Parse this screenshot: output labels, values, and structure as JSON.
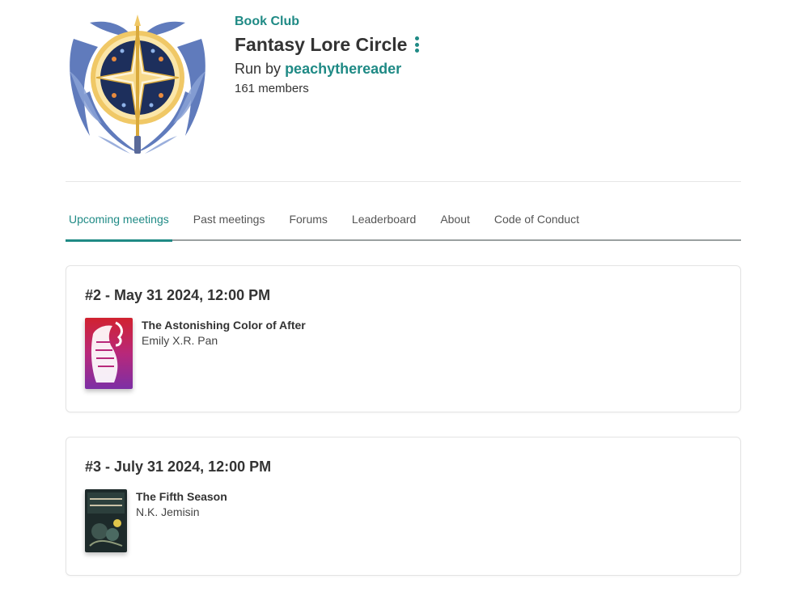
{
  "club": {
    "type": "Book Club",
    "name": "Fantasy Lore Circle",
    "run_by_prefix": "Run by",
    "owner": "peachythereader",
    "members": "161 members"
  },
  "tabs": [
    {
      "label": "Upcoming meetings",
      "active": true
    },
    {
      "label": "Past meetings"
    },
    {
      "label": "Forums"
    },
    {
      "label": "Leaderboard"
    },
    {
      "label": "About"
    },
    {
      "label": "Code of Conduct"
    }
  ],
  "meetings": [
    {
      "title": "#2 - May 31 2024, 12:00 PM",
      "book_title": "The Astonishing Color of After",
      "author": "Emily X.R. Pan"
    },
    {
      "title": "#3 - July 31 2024, 12:00 PM",
      "book_title": "The Fifth Season",
      "author": "N.K. Jemisin"
    }
  ],
  "colors": {
    "accent": "#1f8a85",
    "text": "#333333"
  },
  "icons": {
    "more": "more-vertical-icon",
    "logo": "club-logo-compass-star"
  }
}
